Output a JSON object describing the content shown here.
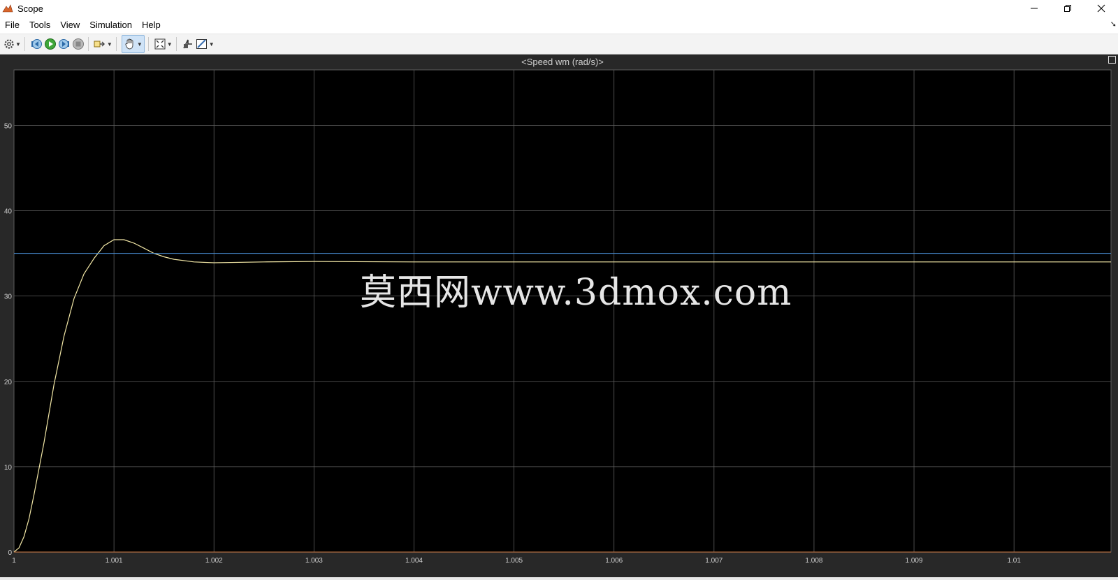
{
  "window": {
    "title": "Scope",
    "icon": "matlab-scope-icon"
  },
  "window_controls": [
    "minimize-icon",
    "restore-icon",
    "close-icon"
  ],
  "menu": {
    "items": [
      "File",
      "Tools",
      "View",
      "Simulation",
      "Help"
    ]
  },
  "toolbar": {
    "buttons": [
      "settings-gear-icon",
      "step-back-icon",
      "run-icon",
      "step-forward-icon",
      "stop-icon",
      "highlight-simulink-block-icon",
      "pan-hand-icon",
      "zoom-fit-icon",
      "autoscale-icon",
      "measurements-icon"
    ]
  },
  "plot": {
    "title": "<Speed wm (rad/s)>",
    "watermark": "莫西网www.3dmox.com"
  },
  "colors": {
    "background": "#000000",
    "grid": "#5e5e5e",
    "signal": "#f2e7a6",
    "reference": "#4a8fd6",
    "zero_line": "#d9824b"
  },
  "chart_data": {
    "type": "line",
    "title": "<Speed wm (rad/s)>",
    "xlabel": "",
    "ylabel": "",
    "xlim": [
      1,
      1.01097
    ],
    "ylim": [
      0,
      56.5
    ],
    "grid": true,
    "x_ticks": [
      "1",
      "1.001",
      "1.002",
      "1.003",
      "1.004",
      "1.005",
      "1.006",
      "1.007",
      "1.008",
      "1.009",
      "1.01"
    ],
    "y_ticks": [
      "0",
      "10",
      "20",
      "30",
      "40",
      "50"
    ],
    "series": [
      {
        "color": "#f2e7a6",
        "x": [
          1.0,
          1.00005,
          1.0001,
          1.00015,
          1.0002,
          1.0003,
          1.0004,
          1.0005,
          1.0006,
          1.0007,
          1.0008,
          1.0009,
          1.001,
          1.0011,
          1.0012,
          1.0013,
          1.0014,
          1.0015,
          1.0016,
          1.0018,
          1.002,
          1.0025,
          1.003,
          1.004,
          1.005,
          1.006,
          1.007,
          1.008,
          1.009,
          1.01,
          1.01097
        ],
        "values": [
          0.0,
          0.5,
          1.8,
          3.9,
          6.7,
          12.8,
          19.6,
          25.3,
          29.7,
          32.6,
          34.4,
          35.9,
          36.6,
          36.6,
          36.2,
          35.6,
          35.0,
          34.6,
          34.3,
          34.0,
          33.9,
          34.0,
          34.05,
          34.0,
          34.0,
          34.0,
          34.0,
          34.0,
          34.0,
          34.0,
          34.0
        ]
      },
      {
        "color": "#4a8fd6",
        "x": [
          1.0,
          1.01097
        ],
        "values": [
          35.0,
          35.0
        ]
      },
      {
        "color": "#d9824b",
        "x": [
          1.0,
          1.01097
        ],
        "values": [
          0.0,
          0.0
        ]
      }
    ]
  }
}
